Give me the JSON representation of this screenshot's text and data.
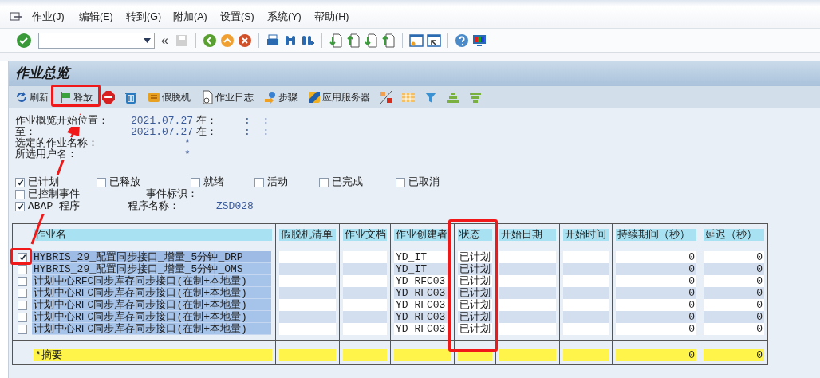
{
  "menu": [
    {
      "label": "作业(J)"
    },
    {
      "label": "编辑(E)"
    },
    {
      "label": "转到(G)"
    },
    {
      "label": "附加(A)"
    },
    {
      "label": "设置(S)"
    },
    {
      "label": "系统(Y)"
    },
    {
      "label": "帮助(H)"
    }
  ],
  "toolbar": {
    "back_arrows": "«"
  },
  "title": "作业总览",
  "app_toolbar": [
    {
      "kind": "text",
      "label": "刷新"
    },
    {
      "kind": "text",
      "label": "释放"
    },
    {
      "kind": "icon"
    },
    {
      "kind": "icon"
    },
    {
      "kind": "text",
      "label": "假脱机"
    },
    {
      "kind": "text",
      "label": "作业日志"
    },
    {
      "kind": "text",
      "label": "步骤"
    },
    {
      "kind": "text",
      "label": "应用服务器"
    },
    {
      "kind": "icon"
    },
    {
      "kind": "icon"
    },
    {
      "kind": "icon"
    },
    {
      "kind": "icon"
    },
    {
      "kind": "icon"
    }
  ],
  "selection": [
    {
      "label": "作业概览开始位置：",
      "date": "2021.07.27",
      "at": "在：",
      "time": ":  :"
    },
    {
      "label": "至：",
      "date": "2021.07.27",
      "at": "在：",
      "time": ":  :"
    }
  ],
  "criteria": [
    {
      "label": "选定的作业名称：",
      "value": "*"
    },
    {
      "label": "所选用户名：",
      "value": "*"
    }
  ],
  "status_filters": [
    {
      "label": "已计划",
      "checked": true
    },
    {
      "label": "已释放",
      "checked": false
    },
    {
      "label": "就绪",
      "checked": false
    },
    {
      "label": "活动",
      "checked": false
    },
    {
      "label": "已完成",
      "checked": false
    },
    {
      "label": "已取消",
      "checked": false
    }
  ],
  "event_filter": {
    "label": "已控制事件",
    "checked": false,
    "id_label": "事件标识："
  },
  "program_filter": {
    "label": "ABAP 程序",
    "checked": true,
    "name_label": "程序名称：",
    "name": "ZSD028"
  },
  "table": {
    "columns": [
      "作业名",
      "假脱机清单",
      "作业文档",
      "作业创建者",
      "状态",
      "开始日期",
      "开始时间",
      "持续期间（秒）",
      "延迟（秒）"
    ],
    "rows": [
      {
        "selected": true,
        "cells": [
          "HYBRIS_29_配置同步接口_增量_5分钟_DRP",
          "",
          "",
          "YD_IT",
          "已计划",
          "",
          "",
          "0",
          "0"
        ]
      },
      {
        "selected": false,
        "cells": [
          "HYBRIS_29_配置同步接口_增量_5分钟_OMS",
          "",
          "",
          "YD_IT",
          "已计划",
          "",
          "",
          "0",
          "0"
        ]
      },
      {
        "selected": false,
        "cells": [
          "计划中心RFC同步库存同步接口(在制+本地量)",
          "",
          "",
          "YD_RFC03",
          "已计划",
          "",
          "",
          "0",
          "0"
        ]
      },
      {
        "selected": false,
        "cells": [
          "计划中心RFC同步库存同步接口(在制+本地量)",
          "",
          "",
          "YD_RFC03",
          "已计划",
          "",
          "",
          "0",
          "0"
        ]
      },
      {
        "selected": false,
        "cells": [
          "计划中心RFC同步库存同步接口(在制+本地量)",
          "",
          "",
          "YD_RFC03",
          "已计划",
          "",
          "",
          "0",
          "0"
        ]
      },
      {
        "selected": false,
        "cells": [
          "计划中心RFC同步库存同步接口(在制+本地量)",
          "",
          "",
          "YD_RFC03",
          "已计划",
          "",
          "",
          "0",
          "0"
        ]
      },
      {
        "selected": false,
        "cells": [
          "计划中心RFC同步库存同步接口(在制+本地量)",
          "",
          "",
          "YD_RFC03",
          "已计划",
          "",
          "",
          "0",
          "0"
        ]
      }
    ],
    "summary": {
      "label": "*摘要",
      "duration": "0",
      "delay": "0"
    }
  }
}
